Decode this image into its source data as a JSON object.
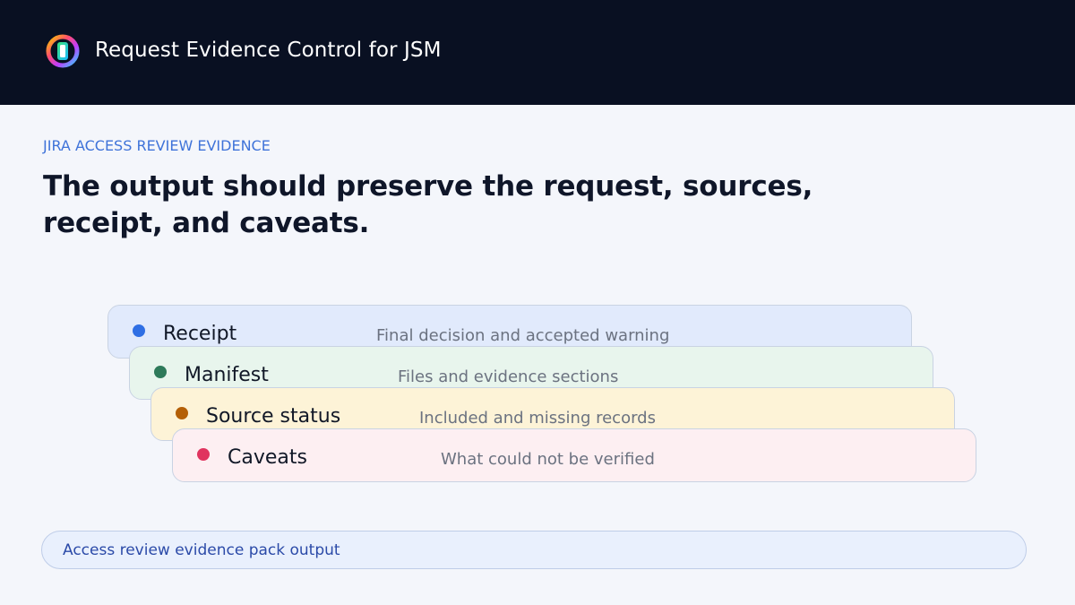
{
  "header": {
    "title": "Request Evidence Control for JSM",
    "logo_icon": "ring-logo-icon",
    "background": "#091022"
  },
  "main": {
    "eyebrow": "JIRA ACCESS REVIEW EVIDENCE",
    "headline": "The output should preserve the request, sources, receipt, and caveats."
  },
  "layers": [
    {
      "label": "Receipt",
      "description": "Final decision and accepted warning",
      "dot_color": "#2f6fe4",
      "background": "#e1eafc"
    },
    {
      "label": "Manifest",
      "description": "Files and evidence sections",
      "dot_color": "#2e7a5a",
      "background": "#e8f5ed"
    },
    {
      "label": "Source status",
      "description": "Included and missing records",
      "dot_color": "#b45f06",
      "background": "#fdf3d7"
    },
    {
      "label": "Caveats",
      "description": "What could not be verified",
      "dot_color": "#e0345f",
      "background": "#fdeff2"
    }
  ],
  "footer": {
    "label": "Access review evidence pack output"
  },
  "colors": {
    "accent": "#3f73d9",
    "footer_text": "#2b4aa8"
  }
}
